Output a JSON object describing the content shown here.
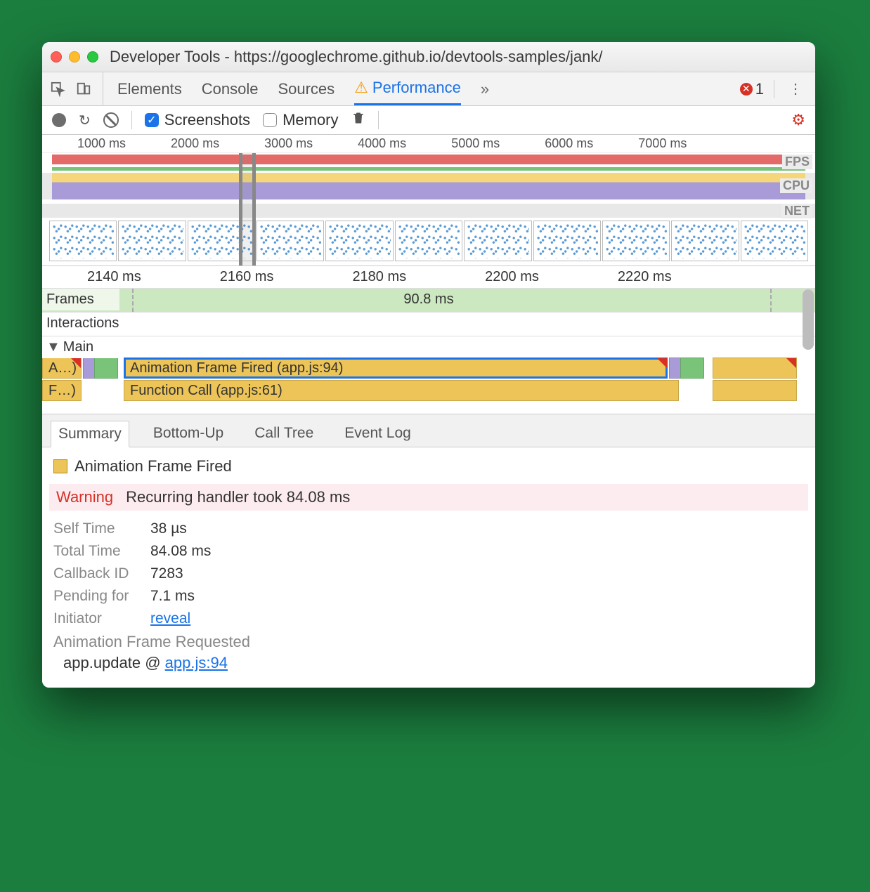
{
  "window": {
    "title": "Developer Tools - https://googlechrome.github.io/devtools-samples/jank/"
  },
  "tabs": {
    "elements": "Elements",
    "console": "Console",
    "sources": "Sources",
    "performance": "Performance",
    "more": "»",
    "error_count": "1"
  },
  "perf_toolbar": {
    "screenshots": "Screenshots",
    "memory": "Memory"
  },
  "overview": {
    "ticks": [
      "1000 ms",
      "2000 ms",
      "3000 ms",
      "4000 ms",
      "5000 ms",
      "6000 ms",
      "7000 ms"
    ],
    "fps_label": "FPS",
    "cpu_label": "CPU",
    "net_label": "NET"
  },
  "flame": {
    "ticks": [
      "2140 ms",
      "2160 ms",
      "2180 ms",
      "2200 ms",
      "2220 ms"
    ],
    "frames_head": "Frames",
    "frames_duration": "90.8 ms",
    "interactions_head": "Interactions",
    "main_head": "Main",
    "row1_left": "A…)",
    "row1_main": "Animation Frame Fired (app.js:94)",
    "row2_left": "F…)",
    "row2_main": "Function Call (app.js:61)"
  },
  "detail_tabs": {
    "summary": "Summary",
    "bottomup": "Bottom-Up",
    "calltree": "Call Tree",
    "eventlog": "Event Log"
  },
  "summary": {
    "event_name": "Animation Frame Fired",
    "warning_label": "Warning",
    "warning_text": "Recurring handler took 84.08 ms",
    "self_time_k": "Self Time",
    "self_time_v": "38 µs",
    "total_time_k": "Total Time",
    "total_time_v": "84.08 ms",
    "callback_id_k": "Callback ID",
    "callback_id_v": "7283",
    "pending_k": "Pending for",
    "pending_v": "7.1 ms",
    "initiator_k": "Initiator",
    "initiator_v": "reveal",
    "stack_title": "Animation Frame Requested",
    "stack_fn": "app.update @ ",
    "stack_src": "app.js:94"
  }
}
